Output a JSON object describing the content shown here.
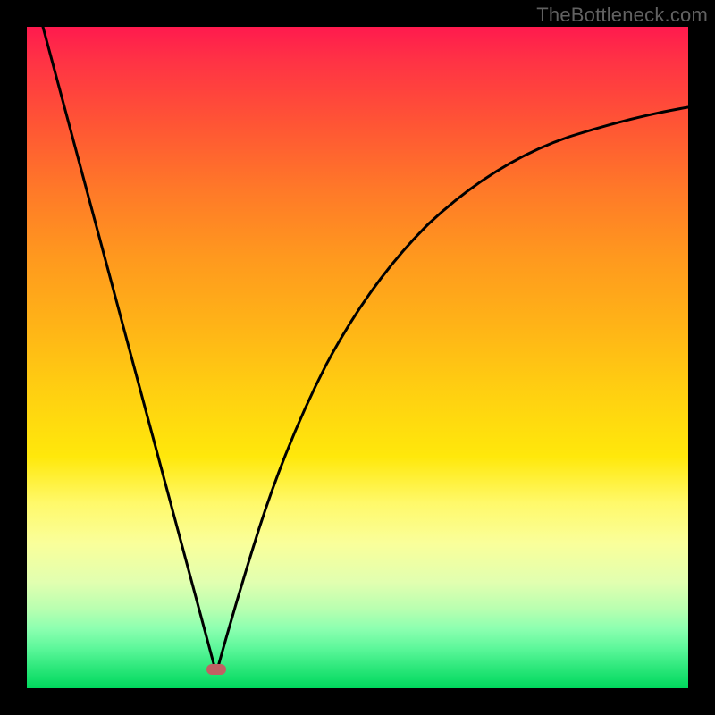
{
  "watermark": "TheBottleneck.com",
  "colors": {
    "frame": "#000000",
    "curve": "#000000",
    "marker": "#c16063"
  },
  "chart_data": {
    "type": "line",
    "title": "",
    "xlabel": "",
    "ylabel": "",
    "xlim": [
      0,
      100
    ],
    "ylim": [
      0,
      100
    ],
    "grid": false,
    "legend": false,
    "note": "V-shaped bottleneck curve. Minimum (optimal balance) at x≈28, y≈0. Left branch: steep near-linear descent from top-left. Right branch: concave curve that rises and flattens toward upper-right, ending near y≈86 at x=100. Values are estimated from pixel positions (no axis ticks/labels visible).",
    "series": [
      {
        "name": "left-branch",
        "x": [
          0,
          5,
          10,
          15,
          20,
          25,
          28
        ],
        "values": [
          100,
          82,
          64,
          46,
          28,
          10,
          0
        ]
      },
      {
        "name": "right-branch",
        "x": [
          28,
          32,
          36,
          40,
          45,
          50,
          55,
          60,
          65,
          70,
          75,
          80,
          85,
          90,
          95,
          100
        ],
        "values": [
          0,
          13,
          24,
          33,
          43,
          51,
          58,
          63,
          68,
          72,
          75,
          78,
          80,
          82,
          84,
          86
        ]
      }
    ],
    "marker": {
      "x": 28,
      "y": 0,
      "shape": "ellipse"
    }
  }
}
